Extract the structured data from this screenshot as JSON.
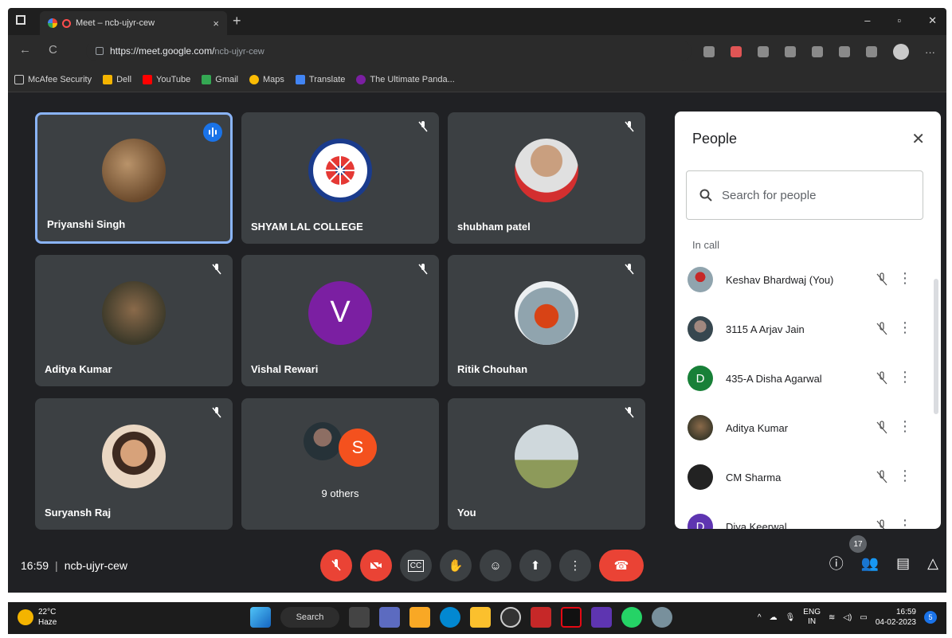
{
  "browser": {
    "tab_title": "Meet – ncb-ujyr-cew",
    "url_host": "https://meet.google.com/",
    "url_path": "ncb-ujyr-cew",
    "bookmarks": [
      "McAfee Security",
      "Dell",
      "YouTube",
      "Gmail",
      "Maps",
      "Translate",
      "The Ultimate Panda..."
    ]
  },
  "tiles": [
    {
      "name": "Priyanshi Singh",
      "speaking": true
    },
    {
      "name": "SHYAM LAL COLLEGE"
    },
    {
      "name": "shubham patel"
    },
    {
      "name": "Aditya Kumar"
    },
    {
      "name": "Vishal Rewari",
      "initial": "V"
    },
    {
      "name": "Ritik Chouhan"
    },
    {
      "name": "Suryansh Raj"
    },
    {
      "name": "9 others",
      "initial": "S"
    },
    {
      "name": "You"
    }
  ],
  "people_panel": {
    "title": "People",
    "search_placeholder": "Search for people",
    "section": "In call",
    "people": [
      {
        "name": "Keshav Bhardwaj (You)"
      },
      {
        "name": "3115 A Arjav Jain"
      },
      {
        "name": "435-A Disha Agarwal",
        "initial": "D"
      },
      {
        "name": "Aditya Kumar"
      },
      {
        "name": "CM Sharma"
      },
      {
        "name": "Diya Keerwal",
        "initial": "D"
      }
    ]
  },
  "meeting": {
    "time": "16:59",
    "code": "ncb-ujyr-cew",
    "participant_count": "17"
  },
  "taskbar": {
    "temp": "22°C",
    "weather": "Haze",
    "search": "Search",
    "lang1": "ENG",
    "lang2": "IN",
    "clock": "16:59",
    "date": "04-02-2023",
    "notifications": "5"
  },
  "colors": {
    "meet_bg": "#202124",
    "tile_bg": "#3c4043",
    "red": "#ea4335",
    "active_border": "#8ab4f8"
  }
}
